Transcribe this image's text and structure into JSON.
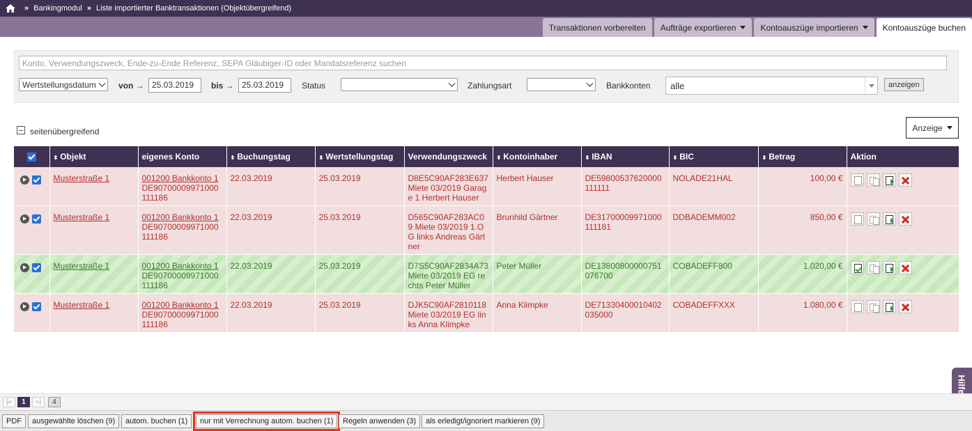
{
  "breadcrumb": {
    "items": [
      "Bankingmodul",
      "Liste importierter Banktransaktionen (Objektübergreifend)"
    ]
  },
  "tabs": [
    {
      "label": "Transaktionen vorbereiten"
    },
    {
      "label": "Aufträge exportieren"
    },
    {
      "label": "Kontoauszüge importieren"
    },
    {
      "label": "Kontoauszüge buchen"
    }
  ],
  "filter": {
    "search_placeholder": "Konto, Verwendungszweck, Ende-zu-Ende Referenz, SEPA Gläubiger-ID oder Mandatsreferenz suchen",
    "date_type": "Wertstellungsdatum",
    "from_label": "von →",
    "from_value": "25.03.2019",
    "to_label": "bis →",
    "to_value": "25.03.2019",
    "status_label": "Status",
    "status_value": "",
    "payment_label": "Zahlungsart",
    "payment_value": "",
    "accounts_label": "Bankkonten",
    "accounts_value": "alle",
    "show_button": "anzeigen"
  },
  "cross_page_label": "seitenübergreifend",
  "view_button": "Anzeige",
  "table": {
    "headers": [
      "Objekt",
      "eigenes Konto",
      "Buchungstag",
      "Wertstellungstag",
      "Verwendungszweck",
      "Kontoinhaber",
      "IBAN",
      "BIC",
      "Betrag",
      "Aktion"
    ],
    "rows": [
      {
        "state": "pink",
        "objekt": "Musterstraße 1",
        "konto_link": "001200 Bankkonto 1",
        "konto_iban": "DE90700009971000111186",
        "buchungstag": "22.03.2019",
        "wertstellung": "25.03.2019",
        "zweck": "D8E5C90AF283E637 Miete 03/2019 Garage 1 Herbert Hauser",
        "inhaber": "Herbert Hauser",
        "iban": "DE59800537620000111111",
        "bic": "NOLADE21HAL",
        "betrag": "100,00 €"
      },
      {
        "state": "pink",
        "objekt": "Musterstraße 1",
        "konto_link": "001200 Bankkonto 1",
        "konto_iban": "DE90700009971000111186",
        "buchungstag": "22.03.2019",
        "wertstellung": "25.03.2019",
        "zweck": "D565C90AF283AC09 Miete 03/2019 1.OG links Andreas Gärtner",
        "inhaber": "Brunhild Gärtner",
        "iban": "DE31700009971000111181",
        "bic": "DDBADEMM002",
        "betrag": "850,00 €"
      },
      {
        "state": "green",
        "objekt": "Musterstraße 1",
        "konto_link": "001200 Bankkonto 1",
        "konto_iban": "DE90700009971000111186",
        "buchungstag": "22.03.2019",
        "wertstellung": "25.03.2019",
        "zweck": "D7S5C90AF2834A73 Miete 03/2019 EG rechts Peter Müller",
        "inhaber": "Peter Müller",
        "iban": "DE13800800000751076700",
        "bic": "COBADEFF800",
        "betrag": "1.020,00 €"
      },
      {
        "state": "pink",
        "objekt": "Musterstraße 1",
        "konto_link": "001200 Bankkonto 1",
        "konto_iban": "DE90700009971000111186",
        "buchungstag": "22.03.2019",
        "wertstellung": "25.03.2019",
        "zweck": "DJK5C90AF2810118 Miete 03/2019 EG links Anna Klimpke",
        "inhaber": "Anna Klimpke",
        "iban": "DE71330400010402035000",
        "bic": "COBADEFFXXX",
        "betrag": "1.080,00 €"
      }
    ]
  },
  "help_tab": "Hilfe",
  "pager": {
    "first": "|«",
    "current": "1",
    "last": "»|",
    "total": "4"
  },
  "bottom_buttons": [
    {
      "label": "PDF"
    },
    {
      "label": "ausgewählte löschen (9)"
    },
    {
      "label": "autom. buchen (1)"
    },
    {
      "label": "nur mit Verrechnung autom. buchen (1)"
    },
    {
      "label": "Regeln anwenden (3)"
    },
    {
      "label": "als erledigt/ignoriert markieren (9)"
    }
  ],
  "colors": {
    "header_bg": "#3f3152",
    "tab_bar": "#8a7496",
    "row_pink": "#f2dede",
    "row_green": "#d7efcf",
    "text_red": "#b03030",
    "text_green": "#3a7a2a",
    "highlight": "#e8321c"
  }
}
